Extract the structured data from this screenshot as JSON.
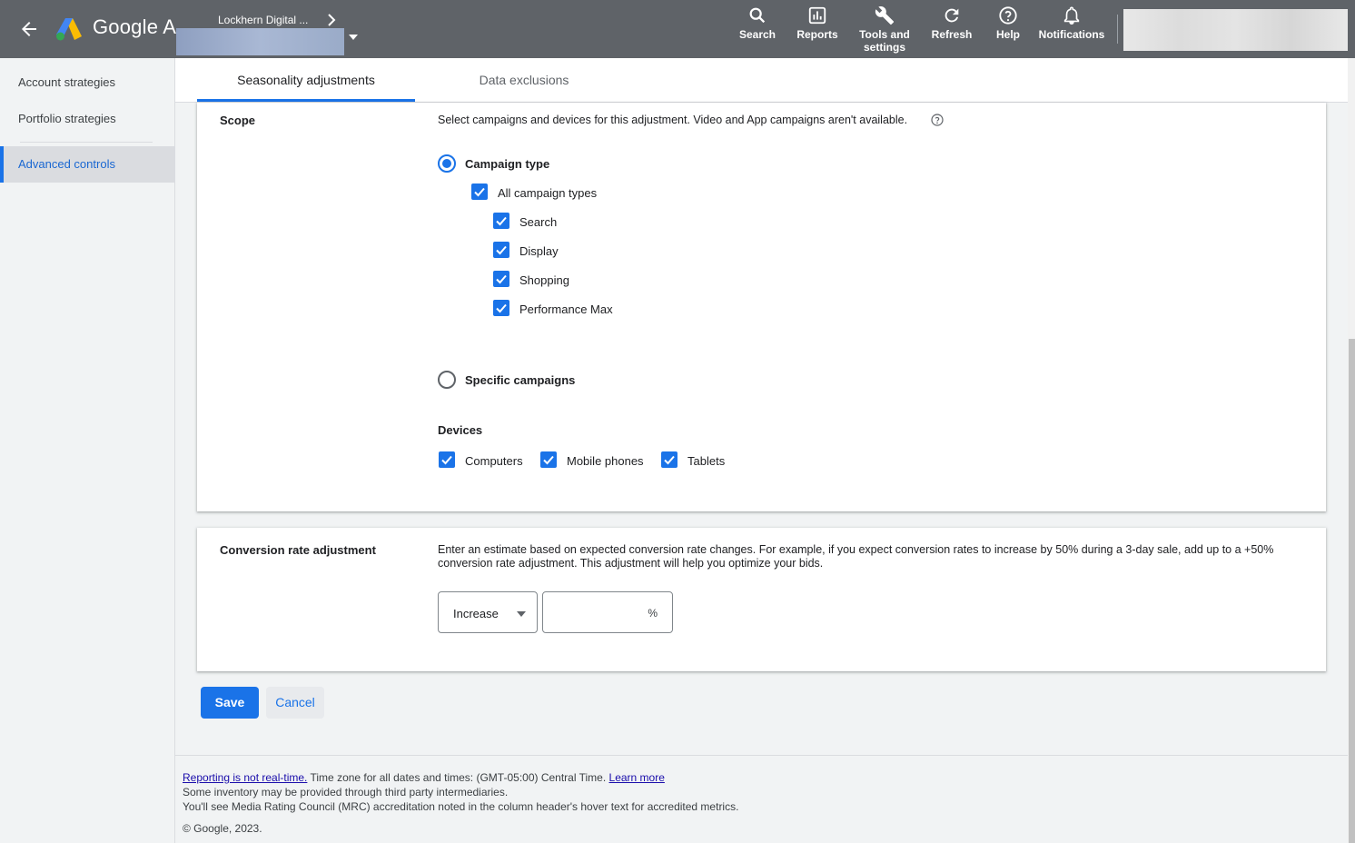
{
  "header": {
    "brand": "Google Ads",
    "account_name": "Lockhern Digital ...",
    "tools": [
      {
        "label": "Search",
        "icon": "search-icon"
      },
      {
        "label": "Reports",
        "icon": "reports-icon"
      },
      {
        "label": "Tools and settings",
        "icon": "wrench-icon"
      },
      {
        "label": "Refresh",
        "icon": "refresh-icon"
      },
      {
        "label": "Help",
        "icon": "help-icon"
      },
      {
        "label": "Notifications",
        "icon": "bell-icon"
      }
    ]
  },
  "sidebar": {
    "items": [
      {
        "label": "Account strategies"
      },
      {
        "label": "Portfolio strategies"
      },
      {
        "label": "Advanced controls",
        "active": true
      }
    ]
  },
  "tabs": [
    {
      "label": "Seasonality adjustments",
      "active": true
    },
    {
      "label": "Data exclusions"
    }
  ],
  "scope": {
    "heading": "Scope",
    "description": "Select campaigns and devices for this adjustment. Video and App campaigns aren't available.",
    "campaign_type_label": "Campaign type",
    "all_types_label": "All campaign types",
    "types": [
      "Search",
      "Display",
      "Shopping",
      "Performance Max"
    ],
    "specific_label": "Specific campaigns",
    "devices_heading": "Devices",
    "devices": [
      "Computers",
      "Mobile phones",
      "Tablets"
    ]
  },
  "conversion": {
    "heading": "Conversion rate adjustment",
    "description_line1": "Enter an estimate based on expected conversion rate changes. For example, if you expect conversion rates to increase by 50% during a 3-day sale, add up to a +50%",
    "description_line2": "conversion rate adjustment. This adjustment will help you optimize your bids.",
    "direction_value": "Increase",
    "percent_value": "",
    "percent_sign": "%"
  },
  "actions": {
    "save_label": "Save",
    "cancel_label": "Cancel"
  },
  "footer": {
    "reporting_link": "Reporting is not real-time.",
    "timezone_text": " Time zone for all dates and times: (GMT-05:00) Central Time. ",
    "learn_more": "Learn more",
    "line2": "Some inventory may be provided through third party intermediaries.",
    "line3": "You'll see Media Rating Council (MRC) accreditation noted in the column header's hover text for accredited metrics.",
    "copyright": "© Google, 2023."
  },
  "colors": {
    "accent": "#1a73e8",
    "topbar": "#5f6368"
  }
}
